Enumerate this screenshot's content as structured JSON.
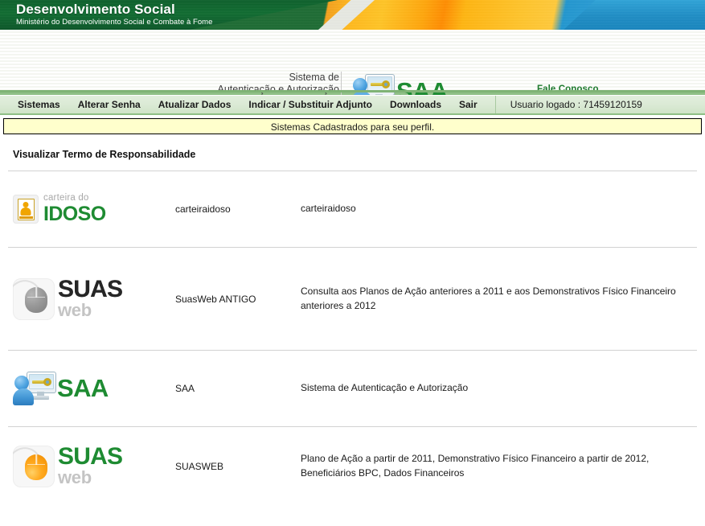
{
  "banner": {
    "title": "Desenvolvimento Social",
    "subtitle": "Ministério do Desenvolvimento Social e Combate à Fome"
  },
  "logo_band": {
    "system_line1": "Sistema de",
    "system_line2": "Autenticação e Autorização",
    "saa_acronym": "SAA",
    "contact_label": "Fale Conosco"
  },
  "nav": {
    "items": [
      {
        "label": "Sistemas",
        "name": "nav-item-sistemas"
      },
      {
        "label": "Alterar Senha",
        "name": "nav-item-alterar-senha"
      },
      {
        "label": "Atualizar Dados",
        "name": "nav-item-atualizar-dados"
      },
      {
        "label": "Indicar / Substituir Adjunto",
        "name": "nav-item-indicar-substituir-adjunto"
      },
      {
        "label": "Downloads",
        "name": "nav-item-downloads"
      },
      {
        "label": "Sair",
        "name": "nav-item-sair"
      }
    ],
    "user_status": "Usuario logado : 71459120159"
  },
  "message_bar": {
    "text": "Sistemas Cadastrados para seu perfil."
  },
  "page": {
    "title": "Visualizar Termo de Responsabilidade"
  },
  "systems": [
    {
      "logo_small": "carteira do",
      "logo_big": "IDOSO",
      "name": "carteiraidoso",
      "description": "carteiraidoso"
    },
    {
      "logo_big": "SUAS",
      "logo_sub": "web",
      "name": "SuasWeb ANTIGO",
      "description": "Consulta aos Planos de Ação anteriores a 2011 e aos Demonstrativos Físico Financeiro anteriores a 2012"
    },
    {
      "logo_big": "SAA",
      "name": "SAA",
      "description": "Sistema de Autenticação e Autorização"
    },
    {
      "logo_big": "SUAS",
      "logo_sub": "web",
      "name": "SUASWEB",
      "description": "Plano de Ação a partir de 2011, Demonstrativo Físico Financeiro a partir de 2012, Beneficiários BPC, Dados Financeiros"
    }
  ],
  "colors": {
    "brand_green": "#1e8b32",
    "header_green": "#0f6b30",
    "nav_green": "#dbead5",
    "message_yellow": "#ffffcc",
    "accent_orange": "#ffb81c",
    "accent_blue": "#1d8cc4"
  }
}
